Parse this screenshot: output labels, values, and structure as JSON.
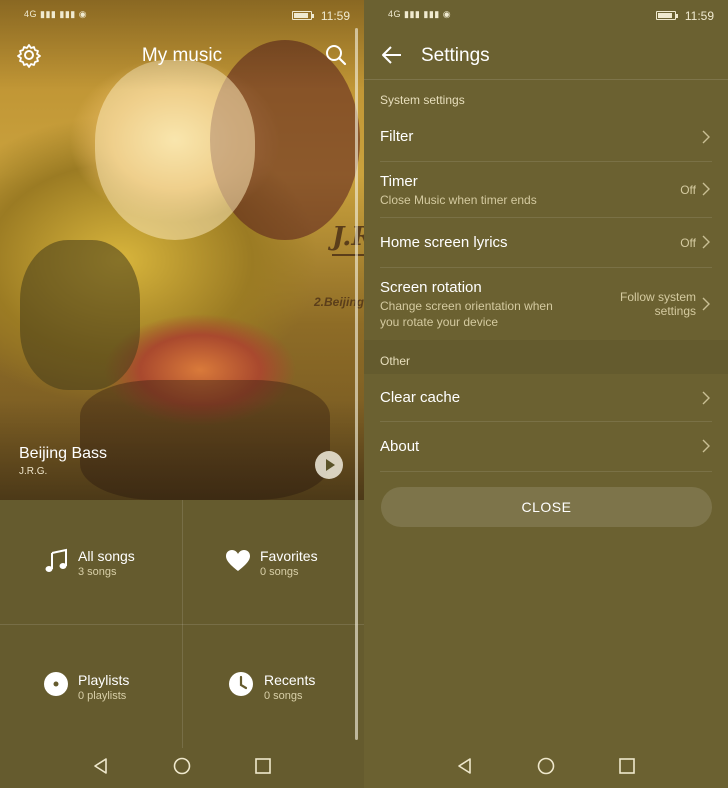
{
  "status_left": {
    "network": "4G",
    "time": "11:59"
  },
  "status_right": {
    "network": "4G",
    "time": "11:59"
  },
  "music": {
    "title": "My music",
    "now_playing": {
      "song": "Beijing Bass",
      "artist": "J.R.G."
    },
    "album_art_text": {
      "logo": "J.R",
      "track": "2.Beijing"
    },
    "grid": [
      {
        "label": "All songs",
        "sub": "3 songs",
        "icon": "music-note-icon"
      },
      {
        "label": "Favorites",
        "sub": "0 songs",
        "icon": "heart-icon"
      },
      {
        "label": "Playlists",
        "sub": "0 playlists",
        "icon": "playlist-disc-icon"
      },
      {
        "label": "Recents",
        "sub": "0 songs",
        "icon": "clock-icon"
      }
    ]
  },
  "settings": {
    "title": "Settings",
    "section_system": "System settings",
    "rows": [
      {
        "title": "Filter",
        "subtitle": "",
        "value": ""
      },
      {
        "title": "Timer",
        "subtitle": "Close Music when timer ends",
        "value": "Off"
      },
      {
        "title": "Home screen lyrics",
        "subtitle": "",
        "value": "Off"
      },
      {
        "title": "Screen rotation",
        "subtitle_line1": "Change screen orientation when",
        "subtitle_line2": "you rotate your device",
        "value_line1": "Follow system",
        "value_line2": "settings"
      }
    ],
    "section_other": "Other",
    "other_rows": [
      {
        "title": "Clear cache"
      },
      {
        "title": "About"
      }
    ],
    "close_label": "CLOSE"
  },
  "colors": {
    "background": "#655b2e",
    "accent": "#ffffff"
  }
}
